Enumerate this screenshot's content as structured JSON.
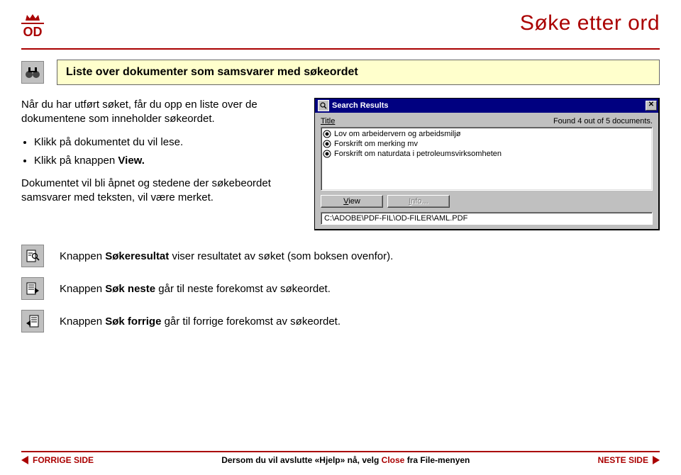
{
  "title": "Søke etter ord",
  "logo_text": "OD",
  "banner": "Liste over dokumenter som samsvarer med søkeordet",
  "intro": "Når du har utført søket, får du opp en liste over de dokumentene som inneholder søkeordet.",
  "bullets": [
    {
      "pre": "Klikk på dokumentet du vil lese.",
      "bold": ""
    },
    {
      "pre": "Klikk på knappen ",
      "bold": "View."
    }
  ],
  "after_bullets": "Dokumentet vil bli åpnet og stedene der søkebeordet samsvarer med teksten, vil være merket.",
  "dialog": {
    "title": "Search Results",
    "title_label": "Title",
    "found": "Found 4 out of 5 documents.",
    "rows": [
      "Lov om arbeidervern og arbeidsmiljø",
      "Forskrift om merking mv",
      "Forskrift om naturdata i petroleumsvirksomheten"
    ],
    "btn_view": "View",
    "btn_info": "Info...",
    "status": "C:\\ADOBE\\PDF-FIL\\OD-FILER\\AML.PDF"
  },
  "notes": [
    {
      "bold": "Søkeresultat",
      "rest": " viser resultatet av søket (som boksen ovenfor).",
      "pre": "Knappen "
    },
    {
      "bold": "Søk neste",
      "rest": " går til neste forekomst av søkeordet.",
      "pre": "Knappen "
    },
    {
      "bold": "Søk forrige",
      "rest": " går til forrige forekomst av søkeordet.",
      "pre": "Knappen "
    }
  ],
  "footer": {
    "prev": "FORRIGE SIDE",
    "next": "NESTE SIDE",
    "center_pre": "Dersom du vil avslutte «Hjelp» nå, velg ",
    "center_red": "Close",
    "center_post": " fra File-menyen"
  }
}
